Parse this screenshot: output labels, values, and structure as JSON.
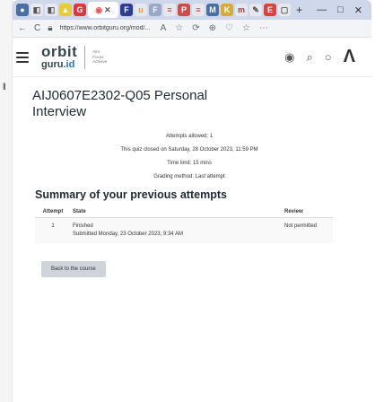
{
  "browser": {
    "tab_active_label": "✕",
    "new_tab": "+",
    "window_controls": [
      "—",
      "□",
      "✕"
    ],
    "url": "https://www.orbitguru.org/mod/...",
    "nav": {
      "back": "←",
      "reload": "C"
    },
    "address_icons": [
      "☆",
      "⟳",
      "⊕",
      "♡",
      "☆",
      "⋯"
    ]
  },
  "site": {
    "logo_main": "orbit",
    "logo_guru": "guru",
    "logo_domain": ".id",
    "logo_tagline": "Aim Focus Achieve"
  },
  "page": {
    "title": "AIJ0607E2302-Q05 Personal Interview",
    "attempts_allowed": "Attempts allowed: 1",
    "closed_on": "This quiz closed on Saturday, 28 October 2023, 11:59 PM",
    "time_limit": "Time limit: 15 mins",
    "grading_method": "Grading method: Last attempt",
    "summary_title": "Summary of your previous attempts"
  },
  "table": {
    "headers": {
      "attempt": "Attempt",
      "state": "State",
      "review": "Review"
    },
    "rows": [
      {
        "attempt": "1",
        "state": "Finished",
        "submitted": "Submitted Monday, 23 October 2023, 9:34 AM",
        "review": "Not permitted"
      }
    ]
  },
  "buttons": {
    "back_to_course": "Back to the course"
  }
}
